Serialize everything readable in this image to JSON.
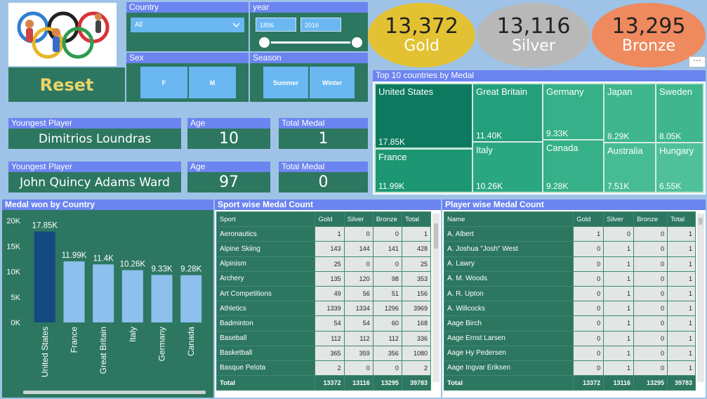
{
  "reset_label": "Reset",
  "filters": {
    "country": {
      "label": "Country",
      "value": "All"
    },
    "year": {
      "label": "year",
      "from": "1896",
      "to": "2016"
    },
    "sex": {
      "label": "Sex",
      "options": [
        "F",
        "M"
      ]
    },
    "season": {
      "label": "Season",
      "options": [
        "Summer",
        "Winter"
      ]
    }
  },
  "medals": {
    "gold": {
      "value": "13,372",
      "label": "Gold",
      "color": "#e2c233"
    },
    "silver": {
      "value": "13,116",
      "label": "Silver",
      "color": "#b8b8b8"
    },
    "bronze": {
      "value": "13,295",
      "label": "Bronze",
      "color": "#ee8a5e"
    }
  },
  "players": [
    {
      "title": "Youngest Player",
      "name": "Dimitrios Loundras",
      "age_label": "Age",
      "age": "10",
      "medal_label": "Total Medal",
      "medals": "1"
    },
    {
      "title": "Youngest Player",
      "name": "John Quincy Adams Ward",
      "age_label": "Age",
      "age": "97",
      "medal_label": "Total Medal",
      "medals": "0"
    }
  ],
  "treemap": {
    "title": "Top 10 countries by Medal",
    "items": [
      {
        "name": "United States",
        "value": "17.85K"
      },
      {
        "name": "France",
        "value": "11.99K"
      },
      {
        "name": "Great Britain",
        "value": "11.40K"
      },
      {
        "name": "Italy",
        "value": "10.26K"
      },
      {
        "name": "Germany",
        "value": "9.33K"
      },
      {
        "name": "Canada",
        "value": "9.28K"
      },
      {
        "name": "Japan",
        "value": "8.29K"
      },
      {
        "name": "Australia",
        "value": "7.51K"
      },
      {
        "name": "Sweden",
        "value": "8.05K"
      },
      {
        "name": "Hungary",
        "value": "6.55K"
      }
    ]
  },
  "chart_data": {
    "type": "bar",
    "title": "Medal won by Country",
    "categories": [
      "United States",
      "France",
      "Great Britain",
      "Italy",
      "Germany",
      "Canada"
    ],
    "values": [
      17850,
      11990,
      11400,
      10260,
      9330,
      9280
    ],
    "data_labels": [
      "17.85K",
      "11.99K",
      "11.4K",
      "10.26K",
      "9.33K",
      "9.28K"
    ],
    "y_ticks": [
      "0K",
      "5K",
      "10K",
      "15K",
      "20K"
    ],
    "ylim": [
      0,
      20000
    ],
    "colors": {
      "highlight": "#154a80",
      "normal": "#8dc0ec"
    }
  },
  "sport_table": {
    "title": "Sport wise Medal Count",
    "columns": [
      "Sport",
      "Gold",
      "Silver",
      "Bronze",
      "Total"
    ],
    "rows": [
      [
        "Aeronautics",
        "1",
        "0",
        "0",
        "1"
      ],
      [
        "Alpine Skiing",
        "143",
        "144",
        "141",
        "428"
      ],
      [
        "Alpinism",
        "25",
        "0",
        "0",
        "25"
      ],
      [
        "Archery",
        "135",
        "120",
        "98",
        "353"
      ],
      [
        "Art Competitions",
        "49",
        "56",
        "51",
        "156"
      ],
      [
        "Athletics",
        "1339",
        "1334",
        "1296",
        "3969"
      ],
      [
        "Badminton",
        "54",
        "54",
        "60",
        "168"
      ],
      [
        "Baseball",
        "112",
        "112",
        "112",
        "336"
      ],
      [
        "Basketball",
        "365",
        "359",
        "356",
        "1080"
      ],
      [
        "Basque Pelota",
        "2",
        "0",
        "0",
        "2"
      ]
    ],
    "total": [
      "Total",
      "13372",
      "13116",
      "13295",
      "39783"
    ]
  },
  "player_table": {
    "title": "Player wise Medal Count",
    "columns": [
      "Name",
      "Gold",
      "Silver",
      "Bronze",
      "Total"
    ],
    "rows": [
      [
        "A. Albert",
        "1",
        "0",
        "0",
        "1"
      ],
      [
        "A. Joshua \"Josh\" West",
        "0",
        "1",
        "0",
        "1"
      ],
      [
        "A. Lawry",
        "0",
        "1",
        "0",
        "1"
      ],
      [
        "A. M. Woods",
        "0",
        "1",
        "0",
        "1"
      ],
      [
        "A. R. Upton",
        "0",
        "1",
        "0",
        "1"
      ],
      [
        "A. Willcocks",
        "0",
        "1",
        "0",
        "1"
      ],
      [
        "Aage Birch",
        "0",
        "1",
        "0",
        "1"
      ],
      [
        "Aage Ernst Larsen",
        "0",
        "1",
        "0",
        "1"
      ],
      [
        "Aage Hy Pedersen",
        "0",
        "1",
        "0",
        "1"
      ],
      [
        "Aage Ingvar Eriksen",
        "0",
        "1",
        "0",
        "1"
      ]
    ],
    "total": [
      "Total",
      "13372",
      "13116",
      "13295",
      "39783"
    ]
  }
}
